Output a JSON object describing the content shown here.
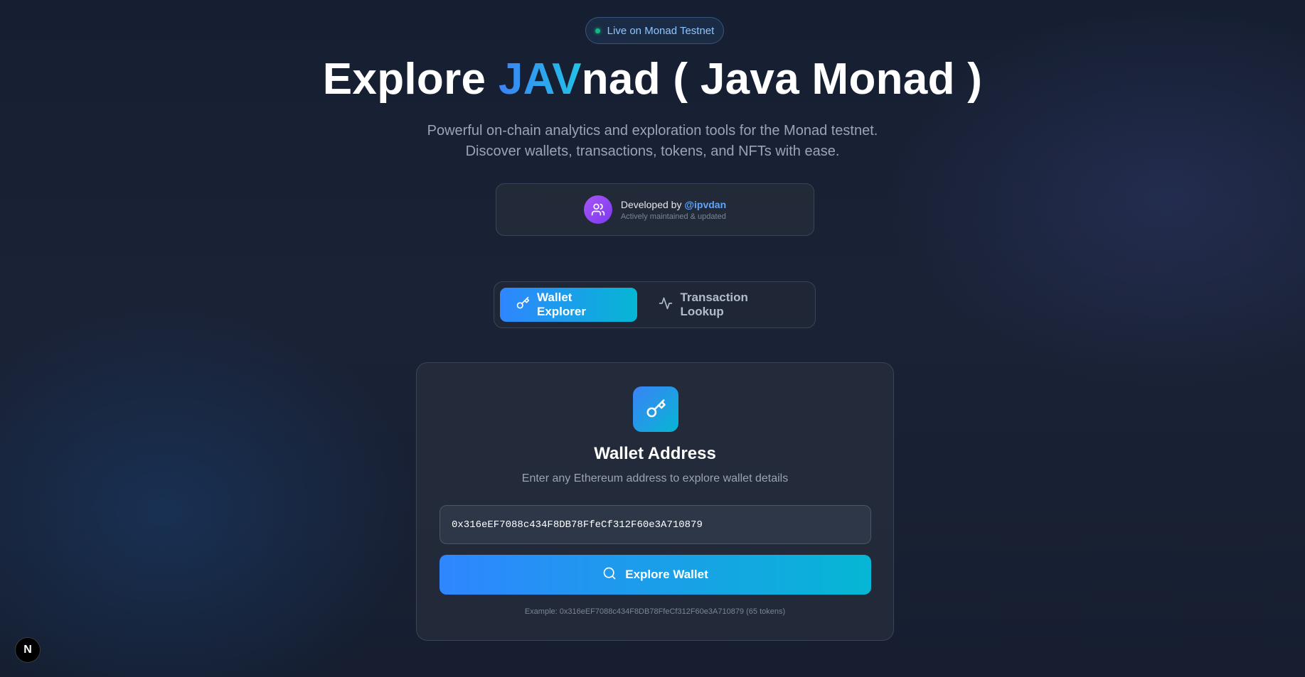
{
  "status_pill": {
    "text": "Live on Monad Testnet",
    "dot_color": "#10b981"
  },
  "hero": {
    "title_prefix": "Explore ",
    "title_accent": "JAV",
    "title_suffix": "nad ( Java Monad )",
    "subtitle_line1": "Powerful on-chain analytics and exploration tools for the Monad testnet.",
    "subtitle_line2": "Discover wallets, transactions, tokens, and NFTs with ease."
  },
  "developer": {
    "prefix": "Developed by ",
    "handle": "@ipvdan",
    "subtitle": "Actively maintained & updated",
    "icon": "users-icon"
  },
  "tabs": [
    {
      "label": "Wallet Explorer",
      "icon": "key-icon",
      "active": true
    },
    {
      "label": "Transaction Lookup",
      "icon": "activity-icon",
      "active": false
    }
  ],
  "wallet_card": {
    "icon": "key-icon",
    "title": "Wallet Address",
    "description": "Enter any Ethereum address to explore wallet details",
    "input_value": "0x316eEF7088c434F8DB78FfeCf312F60e3A710879",
    "button_label": "Explore Wallet",
    "button_icon": "search-icon",
    "example": "Example: 0x316eEF7088c434F8DB78FfeCf312F60e3A710879 (65 tokens)"
  },
  "framework_badge": {
    "letter": "N"
  },
  "colors": {
    "accent_gradient_start": "#2f86ff",
    "accent_gradient_end": "#06b6d4",
    "handle": "#60a5fa",
    "background": "#1a2236"
  }
}
